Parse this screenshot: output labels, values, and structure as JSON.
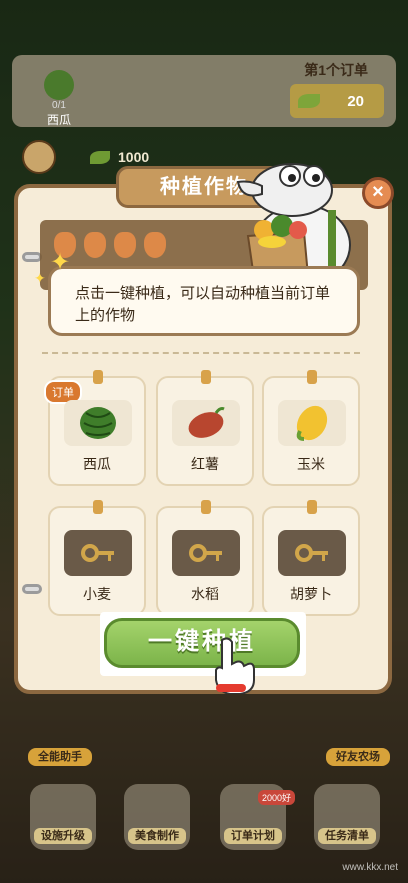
{
  "order": {
    "crop_name": "西瓜",
    "crop_count": "0/1",
    "label": "第1个订单",
    "reward": "20"
  },
  "coins": "1000",
  "panel": {
    "title": "种植作物",
    "tip": "点击一键种植，可以自动种植当前订单上的作物",
    "order_badge": "订单",
    "crops": [
      {
        "name": "西瓜",
        "locked": false,
        "icon": "watermelon-icon"
      },
      {
        "name": "红薯",
        "locked": false,
        "icon": "sweet-potato-icon"
      },
      {
        "name": "玉米",
        "locked": false,
        "icon": "corn-icon"
      },
      {
        "name": "小麦",
        "locked": true,
        "icon": "lock-key-icon"
      },
      {
        "name": "水稻",
        "locked": true,
        "icon": "lock-key-icon"
      },
      {
        "name": "胡萝卜",
        "locked": true,
        "icon": "lock-key-icon"
      }
    ],
    "plant_button": "一键种植"
  },
  "side_buttons": {
    "left": "全能助手",
    "right": "好友农场"
  },
  "bottom_bar": [
    {
      "label": "设施升级"
    },
    {
      "label": "美食制作"
    },
    {
      "label": "订单计划",
      "tag": "2000好"
    },
    {
      "label": "任务清单"
    }
  ],
  "watermark": "www.kkx.net",
  "colors": {
    "panel_bg": "#f6ecd8",
    "panel_border": "#8c6840",
    "plant_button": "#8cc25a",
    "close_button": "#e58c52"
  }
}
